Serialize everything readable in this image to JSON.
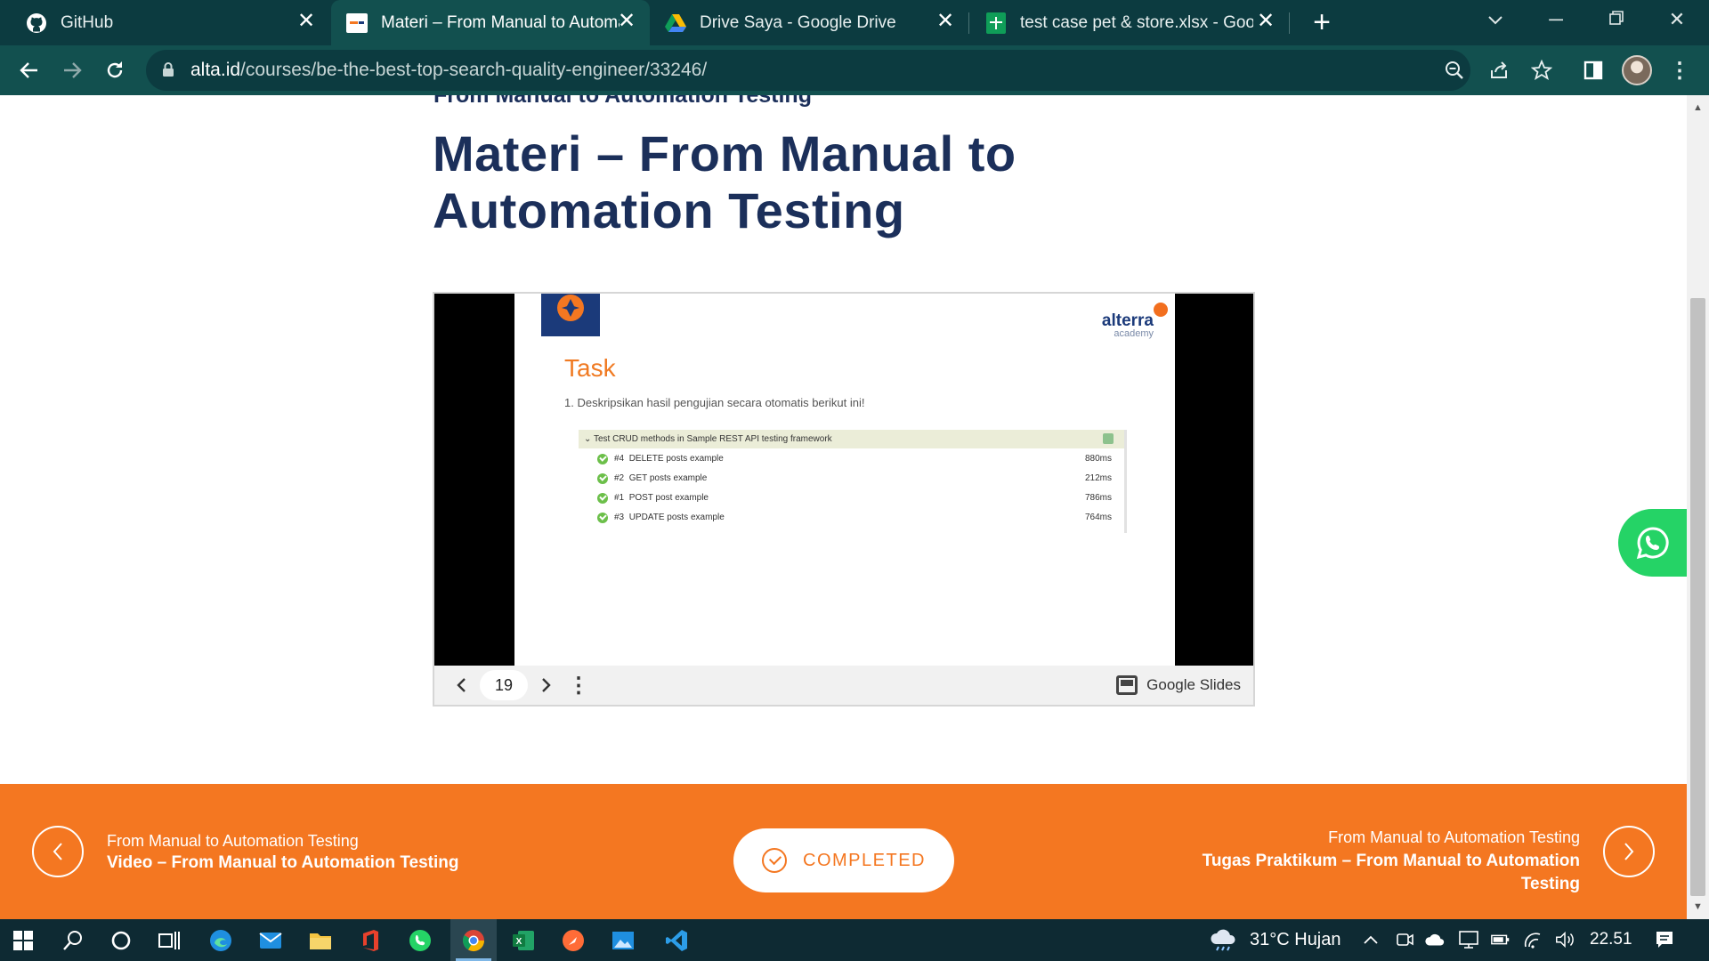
{
  "browser": {
    "tabs": [
      {
        "title": "GitHub",
        "favicon": "github-icon",
        "active": false
      },
      {
        "title": "Materi – From Manual to Automa",
        "favicon": "alta-icon",
        "active": true
      },
      {
        "title": "Drive Saya - Google Drive",
        "favicon": "google-drive-icon",
        "active": false
      },
      {
        "title": "test case pet & store.xlsx - Googl",
        "favicon": "google-sheets-icon",
        "active": false
      }
    ],
    "url_host": "alta.id",
    "url_path": "/courses/be-the-best-top-search-quality-engineer/33246/"
  },
  "page": {
    "breadcrumb": "From Manual to Automation Testing",
    "title": "Materi – From Manual to Automation Testing"
  },
  "slide": {
    "brand": "alterra",
    "brand_sub": "academy",
    "heading": "Task",
    "instruction": "1. Deskripsikan hasil pengujian secara otomatis berikut ini!",
    "suite": "Test CRUD methods in Sample REST API testing framework",
    "results": [
      {
        "id": "#4",
        "name": "DELETE posts example",
        "time": "880ms"
      },
      {
        "id": "#2",
        "name": "GET posts example",
        "time": "212ms"
      },
      {
        "id": "#1",
        "name": "POST post example",
        "time": "786ms"
      },
      {
        "id": "#3",
        "name": "UPDATE posts example",
        "time": "764ms"
      }
    ],
    "page_number": "19",
    "provider": "Google Slides"
  },
  "footer": {
    "prev_sub": "From Manual to Automation Testing",
    "prev_main": "Video – From Manual to Automation Testing",
    "status": "COMPLETED",
    "next_sub": "From Manual to Automation Testing",
    "next_main": "Tugas Praktikum – From Manual to Automation Testing"
  },
  "taskbar": {
    "weather": "31°C  Hujan",
    "clock": "22.51"
  },
  "colors": {
    "brand_navy": "#1b2f5a",
    "accent_orange": "#f47721",
    "chrome_teal": "#12504f",
    "whatsapp_green": "#25d366"
  }
}
